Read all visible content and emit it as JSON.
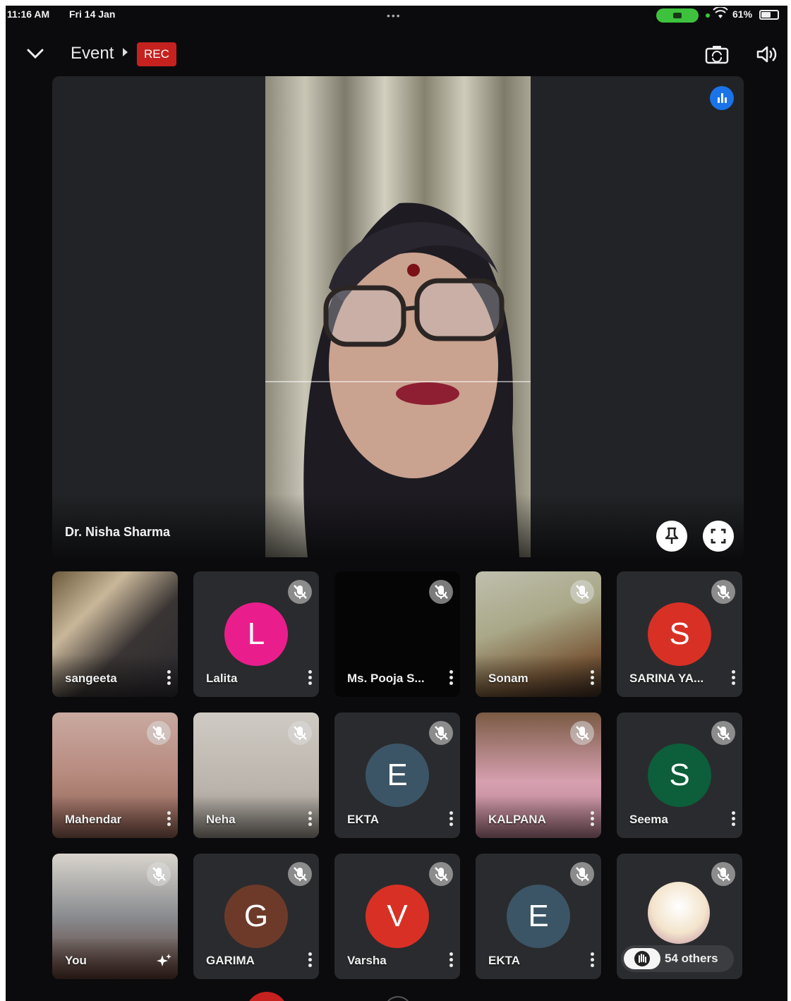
{
  "status_bar": {
    "time": "11:16 AM",
    "date": "Fri 14 Jan",
    "battery": "61%",
    "battery_level": 0.61
  },
  "header": {
    "title": "Event",
    "rec_badge": "REC"
  },
  "main_speaker": {
    "name": "Dr. Nisha Sharma"
  },
  "participants": [
    {
      "name": "sangeeta",
      "type": "video"
    },
    {
      "name": "Lalita",
      "type": "avatar",
      "initial": "L",
      "color": "#e91e8c"
    },
    {
      "name": "Ms. Pooja S...",
      "type": "blank"
    },
    {
      "name": "Sonam",
      "type": "video"
    },
    {
      "name": "SARINA YA...",
      "type": "avatar",
      "initial": "S",
      "color": "#d93025"
    },
    {
      "name": "Mahendar",
      "type": "video"
    },
    {
      "name": "Neha",
      "type": "video"
    },
    {
      "name": "EKTA",
      "type": "avatar",
      "initial": "E",
      "color": "#3b5566"
    },
    {
      "name": "KALPANA",
      "type": "video"
    },
    {
      "name": "Seema",
      "type": "avatar",
      "initial": "S",
      "color": "#0d5e3a"
    },
    {
      "name": "You",
      "type": "video"
    },
    {
      "name": "GARIMA",
      "type": "avatar",
      "initial": "G",
      "color": "#6d3a2a"
    },
    {
      "name": "Varsha",
      "type": "avatar",
      "initial": "V",
      "color": "#d93025"
    },
    {
      "name": "EKTA",
      "type": "avatar",
      "initial": "E",
      "color": "#3b5566"
    },
    {
      "name": "",
      "type": "others"
    }
  ],
  "others_count": "54 others",
  "colors": {
    "rec_red": "#c5221f",
    "voice_blue": "#1a73e8",
    "background": "#0b0b0d"
  }
}
